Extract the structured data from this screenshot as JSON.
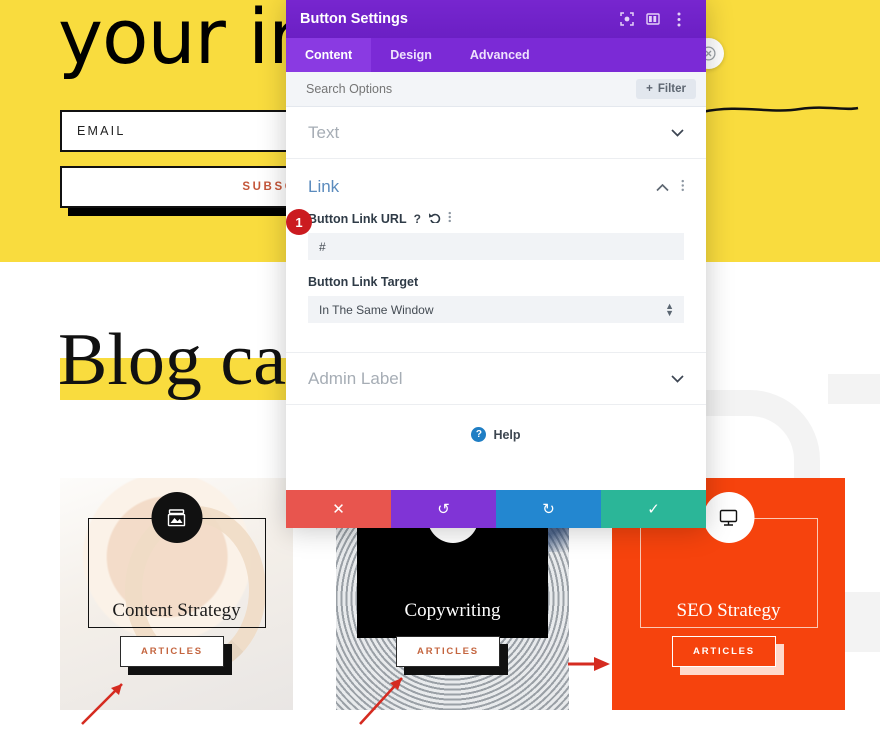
{
  "background": {
    "hero": {
      "heading": "your inbox",
      "email_value": "EMAIL",
      "subscribe_label": "SUBSCRIBE→",
      "close_icon": "close-circle-icon"
    },
    "blog": {
      "heading": "Blog ca"
    },
    "cards": [
      {
        "title": "Content Strategy",
        "button_label": "ARTICLES",
        "icon": "image-box-icon"
      },
      {
        "title": "Copywriting",
        "button_label": "ARTICLES",
        "icon": "documents-icon"
      },
      {
        "title": "SEO Strategy",
        "button_label": "ARTICLES",
        "icon": "monitor-icon"
      }
    ]
  },
  "modal": {
    "title": "Button Settings",
    "header_icons": [
      "focus-target-icon",
      "layout-columns-icon",
      "overflow-menu-icon"
    ],
    "tabs": [
      {
        "label": "Content",
        "active": true
      },
      {
        "label": "Design",
        "active": false
      },
      {
        "label": "Advanced",
        "active": false
      }
    ],
    "search": {
      "placeholder": "Search Options",
      "value": "",
      "filter_label": "Filter",
      "filter_plus": "+"
    },
    "sections": [
      {
        "name": "text",
        "title": "Text",
        "state": "collapsed"
      },
      {
        "name": "link",
        "title": "Link",
        "state": "expanded"
      },
      {
        "name": "admin_label",
        "title": "Admin Label",
        "state": "collapsed"
      }
    ],
    "link_section": {
      "title": "Link",
      "url_field": {
        "label": "Button Link URL",
        "value": "#",
        "help_icon": "question-mark-icon",
        "reset_icon": "undo-icon",
        "options_icon": "overflow-menu-icon"
      },
      "target_field": {
        "label": "Button Link Target",
        "value": "In The Same Window"
      }
    },
    "help_label": "Help",
    "footer_buttons": [
      {
        "name": "cancel",
        "icon": "✕",
        "color": "#e8554e"
      },
      {
        "name": "undo",
        "icon": "↺",
        "color": "#8034d6"
      },
      {
        "name": "redo",
        "icon": "↻",
        "color": "#2387d0"
      },
      {
        "name": "save",
        "icon": "✓",
        "color": "#2bb698"
      }
    ]
  },
  "annotations": {
    "marker_1": "1",
    "arrows": [
      "arrow-to-card-1",
      "arrow-to-card-2",
      "arrow-to-card-3"
    ]
  },
  "colors": {
    "hero_yellow": "#f9dc3e",
    "modal_purple": "#6b1fc4",
    "tab_purple": "#7b2ad6",
    "accent_orange": "#f6430d",
    "marker_red": "#cb1b20",
    "link_blue": "#5b8bbd"
  }
}
